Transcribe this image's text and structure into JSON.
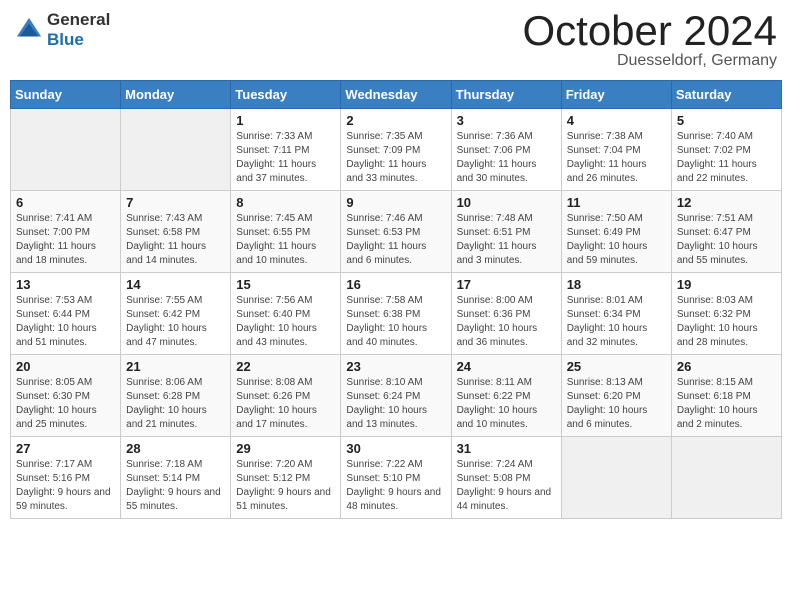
{
  "header": {
    "logo_general": "General",
    "logo_blue": "Blue",
    "month": "October 2024",
    "location": "Duesseldorf, Germany"
  },
  "days_of_week": [
    "Sunday",
    "Monday",
    "Tuesday",
    "Wednesday",
    "Thursday",
    "Friday",
    "Saturday"
  ],
  "weeks": [
    [
      {
        "day": "",
        "empty": true
      },
      {
        "day": "",
        "empty": true
      },
      {
        "day": "1",
        "sunrise": "Sunrise: 7:33 AM",
        "sunset": "Sunset: 7:11 PM",
        "daylight": "Daylight: 11 hours and 37 minutes."
      },
      {
        "day": "2",
        "sunrise": "Sunrise: 7:35 AM",
        "sunset": "Sunset: 7:09 PM",
        "daylight": "Daylight: 11 hours and 33 minutes."
      },
      {
        "day": "3",
        "sunrise": "Sunrise: 7:36 AM",
        "sunset": "Sunset: 7:06 PM",
        "daylight": "Daylight: 11 hours and 30 minutes."
      },
      {
        "day": "4",
        "sunrise": "Sunrise: 7:38 AM",
        "sunset": "Sunset: 7:04 PM",
        "daylight": "Daylight: 11 hours and 26 minutes."
      },
      {
        "day": "5",
        "sunrise": "Sunrise: 7:40 AM",
        "sunset": "Sunset: 7:02 PM",
        "daylight": "Daylight: 11 hours and 22 minutes."
      }
    ],
    [
      {
        "day": "6",
        "sunrise": "Sunrise: 7:41 AM",
        "sunset": "Sunset: 7:00 PM",
        "daylight": "Daylight: 11 hours and 18 minutes."
      },
      {
        "day": "7",
        "sunrise": "Sunrise: 7:43 AM",
        "sunset": "Sunset: 6:58 PM",
        "daylight": "Daylight: 11 hours and 14 minutes."
      },
      {
        "day": "8",
        "sunrise": "Sunrise: 7:45 AM",
        "sunset": "Sunset: 6:55 PM",
        "daylight": "Daylight: 11 hours and 10 minutes."
      },
      {
        "day": "9",
        "sunrise": "Sunrise: 7:46 AM",
        "sunset": "Sunset: 6:53 PM",
        "daylight": "Daylight: 11 hours and 6 minutes."
      },
      {
        "day": "10",
        "sunrise": "Sunrise: 7:48 AM",
        "sunset": "Sunset: 6:51 PM",
        "daylight": "Daylight: 11 hours and 3 minutes."
      },
      {
        "day": "11",
        "sunrise": "Sunrise: 7:50 AM",
        "sunset": "Sunset: 6:49 PM",
        "daylight": "Daylight: 10 hours and 59 minutes."
      },
      {
        "day": "12",
        "sunrise": "Sunrise: 7:51 AM",
        "sunset": "Sunset: 6:47 PM",
        "daylight": "Daylight: 10 hours and 55 minutes."
      }
    ],
    [
      {
        "day": "13",
        "sunrise": "Sunrise: 7:53 AM",
        "sunset": "Sunset: 6:44 PM",
        "daylight": "Daylight: 10 hours and 51 minutes."
      },
      {
        "day": "14",
        "sunrise": "Sunrise: 7:55 AM",
        "sunset": "Sunset: 6:42 PM",
        "daylight": "Daylight: 10 hours and 47 minutes."
      },
      {
        "day": "15",
        "sunrise": "Sunrise: 7:56 AM",
        "sunset": "Sunset: 6:40 PM",
        "daylight": "Daylight: 10 hours and 43 minutes."
      },
      {
        "day": "16",
        "sunrise": "Sunrise: 7:58 AM",
        "sunset": "Sunset: 6:38 PM",
        "daylight": "Daylight: 10 hours and 40 minutes."
      },
      {
        "day": "17",
        "sunrise": "Sunrise: 8:00 AM",
        "sunset": "Sunset: 6:36 PM",
        "daylight": "Daylight: 10 hours and 36 minutes."
      },
      {
        "day": "18",
        "sunrise": "Sunrise: 8:01 AM",
        "sunset": "Sunset: 6:34 PM",
        "daylight": "Daylight: 10 hours and 32 minutes."
      },
      {
        "day": "19",
        "sunrise": "Sunrise: 8:03 AM",
        "sunset": "Sunset: 6:32 PM",
        "daylight": "Daylight: 10 hours and 28 minutes."
      }
    ],
    [
      {
        "day": "20",
        "sunrise": "Sunrise: 8:05 AM",
        "sunset": "Sunset: 6:30 PM",
        "daylight": "Daylight: 10 hours and 25 minutes."
      },
      {
        "day": "21",
        "sunrise": "Sunrise: 8:06 AM",
        "sunset": "Sunset: 6:28 PM",
        "daylight": "Daylight: 10 hours and 21 minutes."
      },
      {
        "day": "22",
        "sunrise": "Sunrise: 8:08 AM",
        "sunset": "Sunset: 6:26 PM",
        "daylight": "Daylight: 10 hours and 17 minutes."
      },
      {
        "day": "23",
        "sunrise": "Sunrise: 8:10 AM",
        "sunset": "Sunset: 6:24 PM",
        "daylight": "Daylight: 10 hours and 13 minutes."
      },
      {
        "day": "24",
        "sunrise": "Sunrise: 8:11 AM",
        "sunset": "Sunset: 6:22 PM",
        "daylight": "Daylight: 10 hours and 10 minutes."
      },
      {
        "day": "25",
        "sunrise": "Sunrise: 8:13 AM",
        "sunset": "Sunset: 6:20 PM",
        "daylight": "Daylight: 10 hours and 6 minutes."
      },
      {
        "day": "26",
        "sunrise": "Sunrise: 8:15 AM",
        "sunset": "Sunset: 6:18 PM",
        "daylight": "Daylight: 10 hours and 2 minutes."
      }
    ],
    [
      {
        "day": "27",
        "sunrise": "Sunrise: 7:17 AM",
        "sunset": "Sunset: 5:16 PM",
        "daylight": "Daylight: 9 hours and 59 minutes."
      },
      {
        "day": "28",
        "sunrise": "Sunrise: 7:18 AM",
        "sunset": "Sunset: 5:14 PM",
        "daylight": "Daylight: 9 hours and 55 minutes."
      },
      {
        "day": "29",
        "sunrise": "Sunrise: 7:20 AM",
        "sunset": "Sunset: 5:12 PM",
        "daylight": "Daylight: 9 hours and 51 minutes."
      },
      {
        "day": "30",
        "sunrise": "Sunrise: 7:22 AM",
        "sunset": "Sunset: 5:10 PM",
        "daylight": "Daylight: 9 hours and 48 minutes."
      },
      {
        "day": "31",
        "sunrise": "Sunrise: 7:24 AM",
        "sunset": "Sunset: 5:08 PM",
        "daylight": "Daylight: 9 hours and 44 minutes."
      },
      {
        "day": "",
        "empty": true
      },
      {
        "day": "",
        "empty": true
      }
    ]
  ]
}
